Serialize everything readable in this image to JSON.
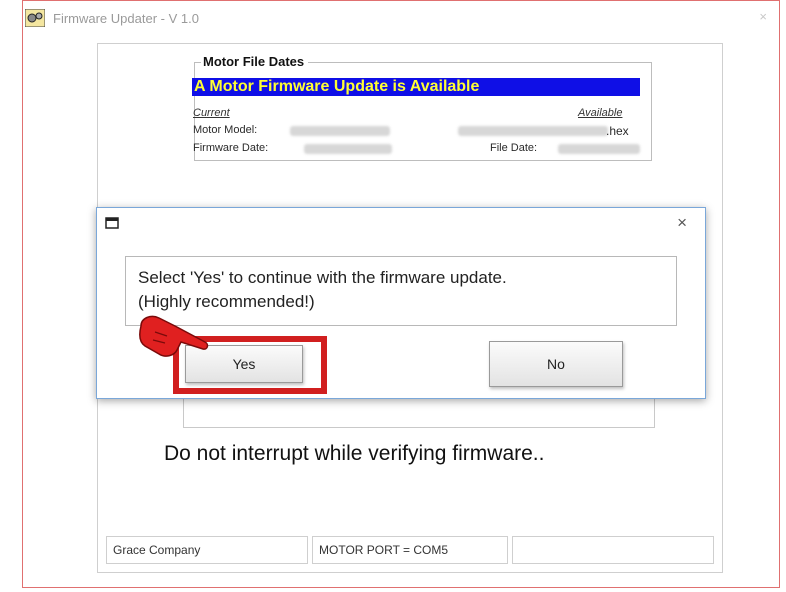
{
  "window": {
    "title": "Firmware Updater - V 1.0",
    "close_glyph": "×",
    "icon": "app-gear-icon"
  },
  "file_dates": {
    "title": "Motor File Dates",
    "banner": "A Motor Firmware Update is Available",
    "current_label": "Current",
    "available_label": "Available",
    "motor_model_label": "Motor Model:",
    "firmware_date_label": "Firmware Date:",
    "file_date_label": "File Date:",
    "hex_suffix": ".hex"
  },
  "main": {
    "verify_message": "Do not interrupt while verifying firmware.."
  },
  "status_bar": {
    "company": "Grace Company",
    "port": "MOTOR PORT = COM5",
    "extra": ""
  },
  "dialog": {
    "close_glyph": "×",
    "message_line1": "Select 'Yes' to continue with the firmware update.",
    "message_line2": "(Highly recommended!)",
    "yes_label": "Yes",
    "no_label": "No"
  },
  "colors": {
    "banner_bg": "#0f0fe6",
    "banner_text": "#ffff33",
    "highlight": "#d11f1f",
    "pointer": "#e02020"
  }
}
